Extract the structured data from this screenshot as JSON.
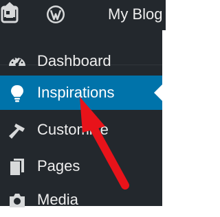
{
  "admin_bar": {
    "icons": [
      "wordpress-icon",
      "home-icon"
    ],
    "site_title": "My Blog",
    "color": "#23282d"
  },
  "sidebar": {
    "background": "#23282d",
    "active_color": "#0073aa",
    "items": [
      {
        "label": "Dashboard",
        "icon": "gauge-icon",
        "active": false
      },
      {
        "label": "Inspirations",
        "icon": "lightbulb-icon",
        "active": true
      },
      {
        "label": "Customize",
        "icon": "hammer-icon",
        "active": false
      },
      {
        "label": "Pages",
        "icon": "pages-icon",
        "active": false
      },
      {
        "label": "Media",
        "icon": "camera-icon",
        "active": false
      }
    ]
  },
  "annotation": {
    "icon": "red-arrow-icon",
    "color": "#e8131a"
  }
}
